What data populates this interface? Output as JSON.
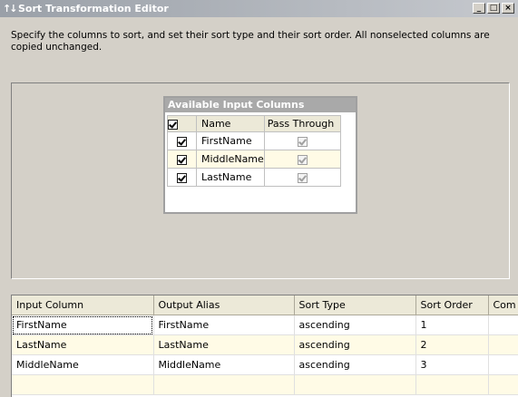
{
  "window": {
    "title_icon": "sort-icon",
    "title": "Sort Transformation Editor",
    "controls": [
      "minimize-button",
      "maximize-button",
      "close-button"
    ]
  },
  "description": "Specify the columns to sort, and set their sort type and their sort order. All nonselected columns are copied unchanged.",
  "available_columns": {
    "title": "Available Input Columns",
    "headers": {
      "name": "Name",
      "pass_through": "Pass Through"
    },
    "header_checked": true,
    "rows": [
      {
        "checked": true,
        "name": "FirstName",
        "pass_through": true
      },
      {
        "checked": true,
        "name": "MiddleName",
        "pass_through": true
      },
      {
        "checked": true,
        "name": "LastName",
        "pass_through": true
      }
    ]
  },
  "sort_grid": {
    "headers": [
      "Input Column",
      "Output Alias",
      "Sort Type",
      "Sort Order",
      "Com"
    ],
    "rows": [
      {
        "input": "FirstName",
        "alias": "FirstName",
        "type": "ascending",
        "order": "1"
      },
      {
        "input": "LastName",
        "alias": "LastName",
        "type": "ascending",
        "order": "2"
      },
      {
        "input": "MiddleName",
        "alias": "MiddleName",
        "type": "ascending",
        "order": "3"
      }
    ]
  },
  "colors": {
    "row_highlight": "#fffbe6",
    "title_gradient_start": "#9aa0a8"
  }
}
